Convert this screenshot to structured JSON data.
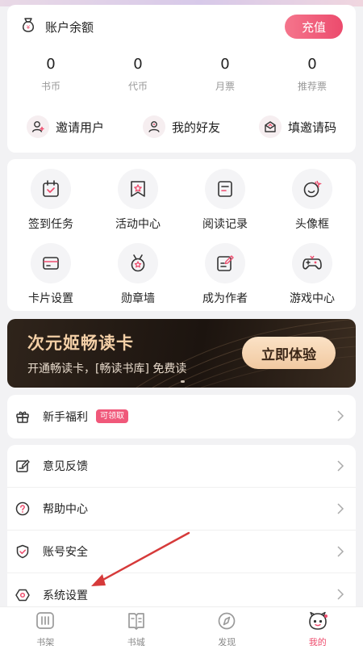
{
  "balance": {
    "title": "账户余额",
    "recharge_label": "充值",
    "stats": [
      {
        "value": "0",
        "label": "书币"
      },
      {
        "value": "0",
        "label": "代币"
      },
      {
        "value": "0",
        "label": "月票"
      },
      {
        "value": "0",
        "label": "推荐票"
      }
    ],
    "actions": [
      {
        "label": "邀请用户",
        "icon": "invite-user-icon"
      },
      {
        "label": "我的好友",
        "icon": "friends-icon"
      },
      {
        "label": "填邀请码",
        "icon": "invite-code-icon"
      }
    ]
  },
  "features": [
    {
      "label": "签到任务",
      "icon": "calendar-check-icon"
    },
    {
      "label": "活动中心",
      "icon": "event-star-icon"
    },
    {
      "label": "阅读记录",
      "icon": "reading-record-icon"
    },
    {
      "label": "头像框",
      "icon": "avatar-frame-icon"
    },
    {
      "label": "卡片设置",
      "icon": "card-icon"
    },
    {
      "label": "勋章墙",
      "icon": "medal-icon"
    },
    {
      "label": "成为作者",
      "icon": "edit-note-icon"
    },
    {
      "label": "游戏中心",
      "icon": "gamepad-icon"
    }
  ],
  "banner": {
    "title": "次元姬畅读卡",
    "subtitle": "开通畅读卡，[畅读书库] 免费读",
    "button_label": "立即体验"
  },
  "newbie": {
    "label": "新手福利",
    "badge": "可领取"
  },
  "menu": [
    {
      "label": "意见反馈",
      "icon": "feedback-icon"
    },
    {
      "label": "帮助中心",
      "icon": "help-icon"
    },
    {
      "label": "账号安全",
      "icon": "shield-icon"
    },
    {
      "label": "系统设置",
      "icon": "settings-icon"
    }
  ],
  "bottom_nav": [
    {
      "label": "书架",
      "icon": "bookshelf-icon"
    },
    {
      "label": "书城",
      "icon": "bookstore-icon"
    },
    {
      "label": "发现",
      "icon": "compass-icon"
    },
    {
      "label": "我的",
      "icon": "profile-mascot-icon"
    }
  ],
  "colors": {
    "accent": "#ee4d6e",
    "banner_gold": "#f3cfa6",
    "annotation_arrow": "#d63a3a"
  }
}
